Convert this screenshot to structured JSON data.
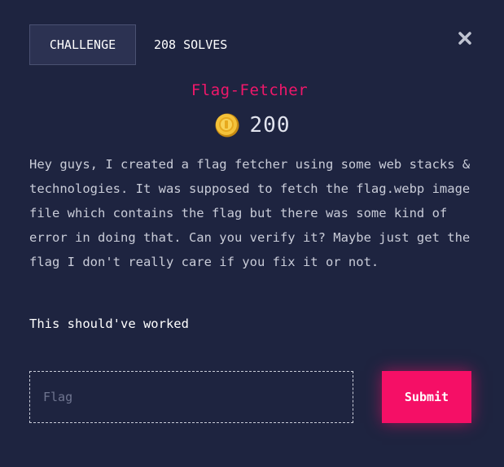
{
  "header": {
    "tabs": [
      {
        "label": "CHALLENGE",
        "active": true
      },
      {
        "label": "208 SOLVES",
        "active": false
      }
    ],
    "close_icon": "close-icon"
  },
  "challenge": {
    "title": "Flag-Fetcher",
    "points": "200",
    "points_icon": "coin-icon",
    "description": "Hey guys, I created a flag fetcher using some web stacks & technologies. It was supposed to fetch the flag.webp image file which contains the flag but there was some kind of error in doing that. Can you verify it? Maybe just get the flag I don't really care if you fix it or not.",
    "note": "This should've worked"
  },
  "form": {
    "flag_placeholder": "Flag",
    "flag_value": "",
    "submit_label": "Submit"
  },
  "colors": {
    "background": "#1e2440",
    "accent": "#f50f66",
    "title": "#f0176a",
    "tab_active_bg": "#2c3252"
  }
}
